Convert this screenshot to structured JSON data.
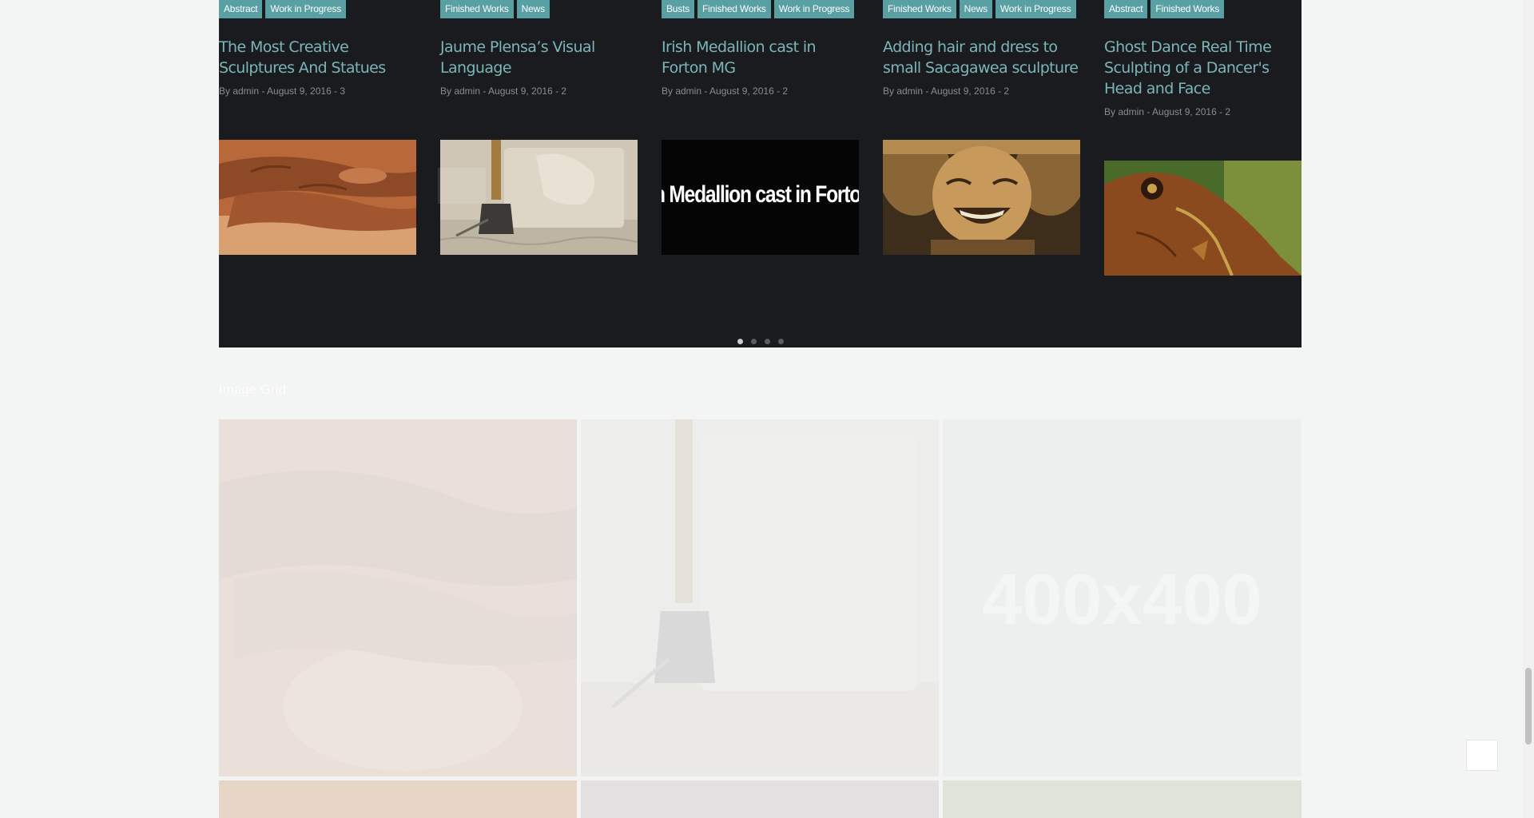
{
  "carousel": {
    "posts": [
      {
        "tags": [
          "Abstract",
          "Work in Progress"
        ],
        "title": "The Most Creative Sculptures And Statues",
        "meta": "By admin - August 9, 2016 - 3",
        "image": "hands-on-clay-pot"
      },
      {
        "tags": [
          "Finished Works",
          "News"
        ],
        "title": "Jaume Plensa’s Visual Language",
        "meta": "By admin - August 9, 2016 - 2",
        "image": "stone-carving-with-mallet"
      },
      {
        "tags": [
          "Busts",
          "Finished Works",
          "Work in Progress"
        ],
        "title": "Irish Medallion cast in Forton MG",
        "meta": "By admin - August 9, 2016 - 2",
        "image_text": "n Medallion cast in Forton"
      },
      {
        "tags": [
          "Finished Works",
          "News",
          "Work in Progress"
        ],
        "title": "Adding hair and dress to small Sacagawea sculpture",
        "meta": "By admin - August 9, 2016 - 2",
        "image": "laughing-buddha-statue"
      },
      {
        "tags": [
          "Abstract",
          "Finished Works"
        ],
        "title": "Ghost Dance Real Time Sculpting of a Dancer's Head and Face",
        "meta": "By admin - August 9, 2016 - 2",
        "image": "fish-sculpture"
      }
    ],
    "dots": 4,
    "active_dot": 1
  },
  "image_grid": {
    "title": "Image Grid",
    "placeholder_text": "400x400"
  },
  "colors": {
    "tag_bg": "#58a0a3",
    "title_text": "#7ab6b9",
    "carousel_bg": "#1a1b1e",
    "page_bg": "#f3f4f4"
  }
}
